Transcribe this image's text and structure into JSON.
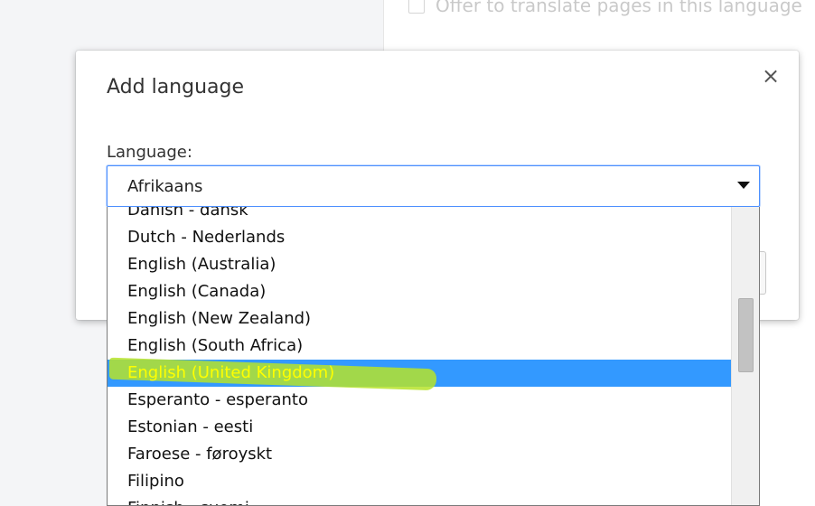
{
  "background": {
    "checkbox_label": "Offer to translate pages in this language"
  },
  "dialog": {
    "title": "Add language",
    "close_icon": "×",
    "language_label": "Language:",
    "select": {
      "value": "Afrikaans",
      "arrow_icon": "chevron-down-icon"
    }
  },
  "dropdown": {
    "options": [
      "Danish - dansk",
      "Dutch - Nederlands",
      "English (Australia)",
      "English (Canada)",
      "English (New Zealand)",
      "English (South Africa)",
      "English (United Kingdom)",
      "Esperanto - esperanto",
      "Estonian - eesti",
      "Faroese - føroyskt",
      "Filipino",
      "Finnish - suomi"
    ],
    "selected_option": "English (United Kingdom)",
    "highlight_color": "#3399ff",
    "selected_text_color": "#ffff00",
    "marker_color": "#b6e32a"
  }
}
